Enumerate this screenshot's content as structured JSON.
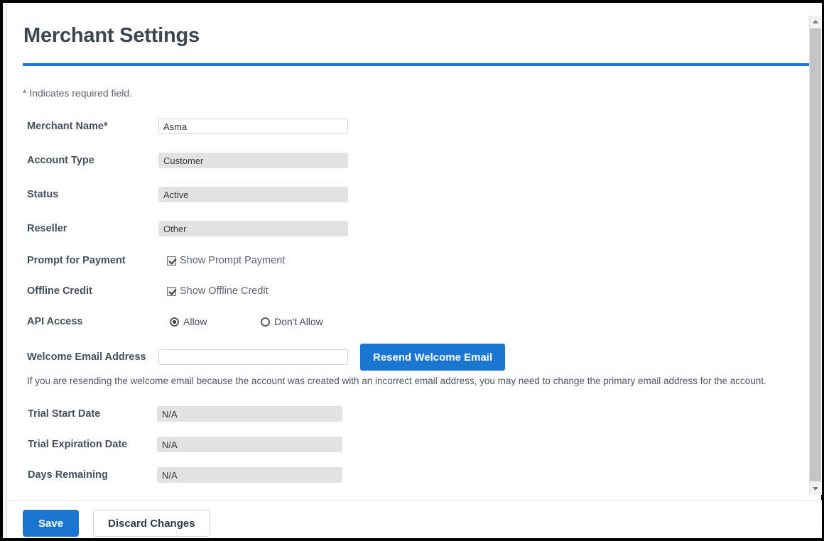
{
  "page": {
    "title": "Merchant Settings",
    "required_note": "* Indicates required field.",
    "accent_color": "#1b76d2",
    "rule_color": "#1b77d3"
  },
  "form": {
    "fields": [
      {
        "label": "Merchant Name*",
        "value": "Asma",
        "type": "text",
        "disabled": false
      },
      {
        "label": "Account Type",
        "value": "Customer",
        "type": "text",
        "disabled": true
      },
      {
        "label": "Status",
        "value": "Active",
        "type": "text",
        "disabled": true
      },
      {
        "label": "Reseller",
        "value": "Other",
        "type": "text",
        "disabled": true
      }
    ],
    "prompt_for_payment": {
      "label": "Prompt for Payment",
      "checkbox_label": "Show Prompt Payment",
      "checked": true
    },
    "offline_credit": {
      "label": "Offline Credit",
      "checkbox_label": "Show Offline Credit",
      "checked": true
    },
    "api_access": {
      "label": "API Access",
      "options": [
        {
          "label": "Allow",
          "selected": true
        },
        {
          "label": "Don't Allow",
          "selected": false
        }
      ]
    },
    "welcome_email": {
      "label": "Welcome Email Address",
      "value": "",
      "placeholder": "",
      "button_label": "Resend Welcome Email",
      "help_text": "If you are resending the welcome email because the account was created with an incorrect email address, you may need to change the primary email address for the account."
    },
    "trial": [
      {
        "label": "Trial Start Date",
        "value": "N/A",
        "disabled": true
      },
      {
        "label": "Trial Expiration Date",
        "value": "N/A",
        "disabled": true
      },
      {
        "label": "Days Remaining",
        "value": "N/A",
        "disabled": true
      }
    ]
  },
  "footer": {
    "save_label": "Save",
    "discard_label": "Discard Changes"
  },
  "scrollbar": {
    "up_icon": "chevron-up-icon",
    "down_icon": "chevron-down-icon"
  }
}
